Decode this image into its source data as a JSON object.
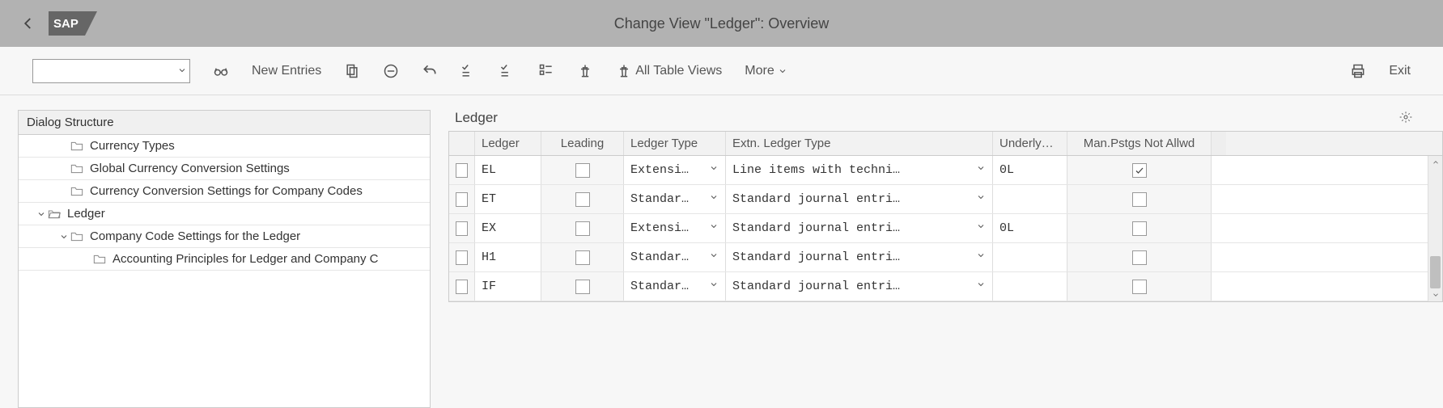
{
  "header": {
    "title": "Change View \"Ledger\": Overview"
  },
  "toolbar": {
    "new_entries": "New Entries",
    "all_table_views": "All Table Views",
    "more": "More",
    "exit": "Exit"
  },
  "tree": {
    "header": "Dialog Structure",
    "items": [
      {
        "label": "Currency Types",
        "indent": 1,
        "open": false,
        "toggle": false
      },
      {
        "label": "Global Currency Conversion Settings",
        "indent": 1,
        "open": false,
        "toggle": false
      },
      {
        "label": "Currency Conversion Settings for Company Codes",
        "indent": 1,
        "open": false,
        "toggle": false
      },
      {
        "label": "Ledger",
        "indent": 0,
        "open": true,
        "toggle": true
      },
      {
        "label": "Company Code Settings for the Ledger",
        "indent": 1,
        "open": false,
        "toggle": true
      },
      {
        "label": "Accounting Principles for Ledger and Company C",
        "indent": 2,
        "open": false,
        "toggle": false
      }
    ]
  },
  "table": {
    "title": "Ledger",
    "columns": {
      "ledger": "Ledger",
      "leading": "Leading",
      "ledger_type": "Ledger Type",
      "extn": "Extn. Ledger Type",
      "underly": "Underly…",
      "man": "Man.Pstgs Not Allwd"
    },
    "rows": [
      {
        "ledger": "EL",
        "leading": false,
        "ledger_type": "Extensi…",
        "extn": "Line items with techni…",
        "underly": "0L",
        "man": true
      },
      {
        "ledger": "ET",
        "leading": false,
        "ledger_type": "Standar…",
        "extn": "Standard journal entri…",
        "underly": "",
        "man": false
      },
      {
        "ledger": "EX",
        "leading": false,
        "ledger_type": "Extensi…",
        "extn": "Standard journal entri…",
        "underly": "0L",
        "man": false
      },
      {
        "ledger": "H1",
        "leading": false,
        "ledger_type": "Standar…",
        "extn": "Standard journal entri…",
        "underly": "",
        "man": false
      },
      {
        "ledger": "IF",
        "leading": false,
        "ledger_type": "Standar…",
        "extn": "Standard journal entri…",
        "underly": "",
        "man": false
      }
    ]
  }
}
